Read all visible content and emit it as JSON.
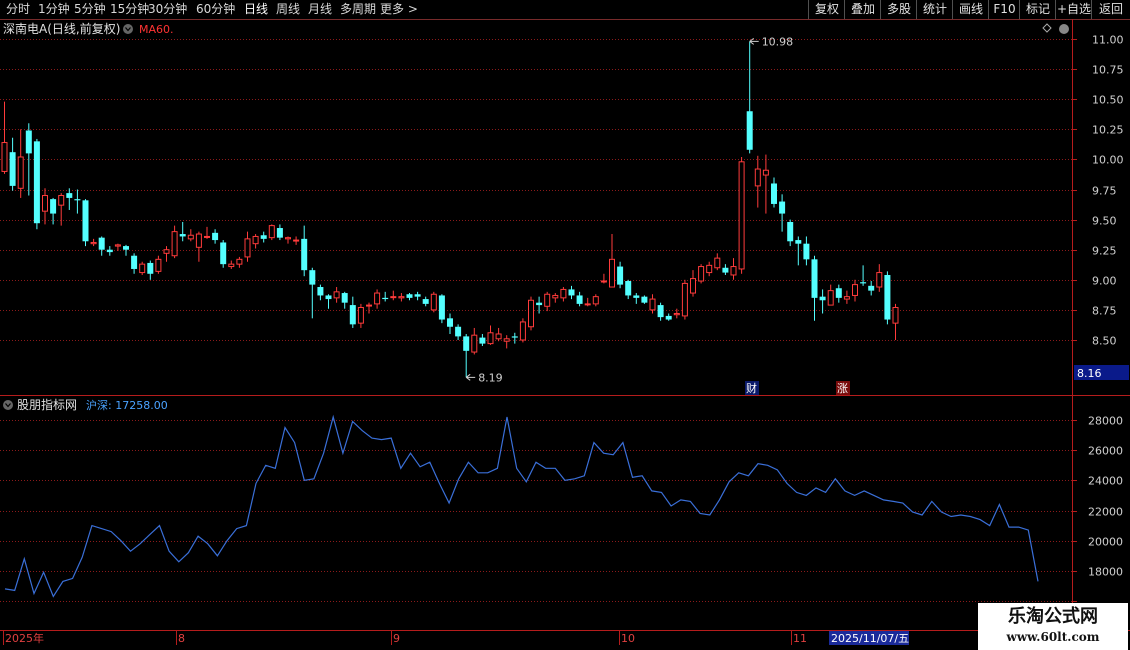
{
  "toolbar": {
    "periods": [
      "分时",
      "1分钟",
      "5分钟",
      "15分钟",
      "30分钟",
      "60分钟",
      "日线",
      "周线",
      "月线",
      "多周期",
      "更多 >"
    ],
    "active_period": "日线",
    "actions": [
      "复权",
      "叠加",
      "多股",
      "统计",
      "画线",
      "F10",
      "标记",
      "+自选",
      "返回"
    ]
  },
  "colors": {
    "up": "#ff3b3b",
    "down": "#54ffff",
    "grid": "#8b1a1a",
    "axis_red": "#b51c1c",
    "line": "#3a6fd8",
    "ma": "#ff3333",
    "label_blue": "#4aa2ff"
  },
  "price_panel": {
    "title": "深南电A(日线,前复权)",
    "indicator": "MA60.",
    "high_marker": "10.98",
    "low_marker": "8.19",
    "current_price": "8.16",
    "event_badges": [
      "财",
      "涨"
    ],
    "settings_icon": "diamond-icon"
  },
  "indicator_panel": {
    "title": "股朋指标网",
    "value_label": "沪深: 17258.00"
  },
  "time_axis": {
    "labels": [
      "2025年",
      "8",
      "9",
      "10",
      "11"
    ],
    "crosshair_date": "2025/11/07/五"
  },
  "watermark": {
    "line1": "乐淘公式网",
    "line2": "www.60lt.com"
  },
  "chart_data": [
    {
      "type": "candlestick",
      "title": "深南电A(日线,前复权)",
      "ylim": [
        8.3,
        11.1
      ],
      "yticks": [
        8.5,
        8.75,
        9.0,
        9.25,
        9.5,
        9.75,
        10.0,
        10.25,
        10.5,
        10.75,
        11.0
      ],
      "annotations": [
        {
          "label": "10.98",
          "value": 10.98
        },
        {
          "label": "8.19",
          "value": 8.19
        }
      ],
      "candles": [
        [
          9.9,
          10.14,
          10.48,
          9.88
        ],
        [
          10.06,
          9.78,
          10.18,
          9.74
        ],
        [
          9.76,
          10.02,
          10.25,
          9.68
        ],
        [
          10.24,
          10.05,
          10.3,
          9.7
        ],
        [
          10.15,
          9.47,
          10.17,
          9.42
        ],
        [
          9.57,
          9.7,
          9.76,
          9.46
        ],
        [
          9.67,
          9.55,
          9.68,
          9.46
        ],
        [
          9.62,
          9.7,
          9.72,
          9.45
        ],
        [
          9.72,
          9.68,
          9.76,
          9.58
        ],
        [
          9.67,
          9.66,
          9.75,
          9.55
        ],
        [
          9.66,
          9.32,
          9.67,
          9.28
        ],
        [
          9.3,
          9.31,
          9.34,
          9.28
        ],
        [
          9.35,
          9.25,
          9.36,
          9.2
        ],
        [
          9.25,
          9.23,
          9.28,
          9.2
        ],
        [
          9.28,
          9.29,
          9.3,
          9.24
        ],
        [
          9.28,
          9.25,
          9.29,
          9.2
        ],
        [
          9.2,
          9.09,
          9.22,
          9.05
        ],
        [
          9.06,
          9.13,
          9.15,
          9.04
        ],
        [
          9.14,
          9.05,
          9.16,
          9.0
        ],
        [
          9.07,
          9.17,
          9.2,
          9.05
        ],
        [
          9.22,
          9.25,
          9.28,
          9.15
        ],
        [
          9.2,
          9.4,
          9.45,
          9.18
        ],
        [
          9.38,
          9.36,
          9.48,
          9.32
        ],
        [
          9.34,
          9.37,
          9.42,
          9.32
        ],
        [
          9.27,
          9.38,
          9.4,
          9.15
        ],
        [
          9.36,
          9.36,
          9.44,
          9.34
        ],
        [
          9.39,
          9.33,
          9.42,
          9.3
        ],
        [
          9.31,
          9.13,
          9.33,
          9.1
        ],
        [
          9.11,
          9.13,
          9.16,
          9.09
        ],
        [
          9.13,
          9.17,
          9.19,
          9.1
        ],
        [
          9.19,
          9.34,
          9.4,
          9.15
        ],
        [
          9.3,
          9.36,
          9.38,
          9.26
        ],
        [
          9.37,
          9.34,
          9.4,
          9.31
        ],
        [
          9.35,
          9.45,
          9.46,
          9.33
        ],
        [
          9.43,
          9.35,
          9.46,
          9.33
        ],
        [
          9.34,
          9.35,
          9.36,
          9.3
        ],
        [
          9.33,
          9.33,
          9.36,
          9.29
        ],
        [
          9.34,
          9.08,
          9.45,
          9.03
        ],
        [
          9.08,
          8.96,
          9.1,
          8.68
        ],
        [
          8.94,
          8.87,
          8.96,
          8.83
        ],
        [
          8.87,
          8.84,
          8.88,
          8.76
        ],
        [
          8.85,
          8.9,
          8.94,
          8.81
        ],
        [
          8.89,
          8.81,
          8.9,
          8.76
        ],
        [
          8.79,
          8.63,
          8.86,
          8.6
        ],
        [
          8.64,
          8.77,
          8.8,
          8.6
        ],
        [
          8.79,
          8.79,
          8.81,
          8.72
        ],
        [
          8.8,
          8.89,
          8.92,
          8.76
        ],
        [
          8.85,
          8.84,
          8.9,
          8.82
        ],
        [
          8.86,
          8.86,
          8.91,
          8.83
        ],
        [
          8.85,
          8.86,
          8.89,
          8.82
        ],
        [
          8.88,
          8.85,
          8.89,
          8.83
        ],
        [
          8.88,
          8.86,
          8.9,
          8.83
        ],
        [
          8.84,
          8.8,
          8.86,
          8.78
        ],
        [
          8.75,
          8.88,
          8.9,
          8.73
        ],
        [
          8.87,
          8.67,
          8.88,
          8.64
        ],
        [
          8.68,
          8.61,
          8.72,
          8.55
        ],
        [
          8.61,
          8.53,
          8.63,
          8.5
        ],
        [
          8.53,
          8.41,
          8.55,
          8.19
        ],
        [
          8.4,
          8.54,
          8.6,
          8.38
        ],
        [
          8.52,
          8.47,
          8.55,
          8.45
        ],
        [
          8.47,
          8.56,
          8.62,
          8.46
        ],
        [
          8.51,
          8.55,
          8.6,
          8.49
        ],
        [
          8.49,
          8.51,
          8.54,
          8.43
        ],
        [
          8.53,
          8.52,
          8.56,
          8.47
        ],
        [
          8.5,
          8.65,
          8.68,
          8.48
        ],
        [
          8.61,
          8.83,
          8.86,
          8.58
        ],
        [
          8.81,
          8.79,
          8.86,
          8.72
        ],
        [
          8.78,
          8.88,
          8.9,
          8.74
        ],
        [
          8.85,
          8.87,
          8.89,
          8.81
        ],
        [
          8.85,
          8.92,
          8.94,
          8.82
        ],
        [
          8.92,
          8.87,
          8.95,
          8.84
        ],
        [
          8.87,
          8.8,
          8.9,
          8.78
        ],
        [
          8.8,
          8.8,
          8.85,
          8.78
        ],
        [
          8.8,
          8.86,
          8.88,
          8.78
        ],
        [
          8.99,
          8.99,
          9.05,
          8.97
        ],
        [
          8.94,
          9.17,
          9.38,
          8.96
        ],
        [
          9.11,
          8.96,
          9.15,
          8.93
        ],
        [
          8.99,
          8.87,
          9.0,
          8.84
        ],
        [
          8.87,
          8.85,
          8.89,
          8.8
        ],
        [
          8.86,
          8.81,
          8.87,
          8.8
        ],
        [
          8.75,
          8.84,
          8.88,
          8.72
        ],
        [
          8.79,
          8.69,
          8.81,
          8.66
        ],
        [
          8.7,
          8.67,
          8.72,
          8.66
        ],
        [
          8.71,
          8.72,
          8.76,
          8.68
        ],
        [
          8.7,
          8.97,
          9.0,
          8.67
        ],
        [
          8.89,
          9.01,
          9.08,
          8.86
        ],
        [
          8.99,
          9.11,
          9.13,
          8.97
        ],
        [
          9.06,
          9.12,
          9.15,
          9.03
        ],
        [
          9.1,
          9.18,
          9.22,
          9.08
        ],
        [
          9.1,
          9.06,
          9.13,
          9.04
        ],
        [
          9.04,
          9.11,
          9.18,
          9.0
        ],
        [
          9.09,
          9.98,
          10.02,
          9.05
        ],
        [
          10.4,
          10.08,
          10.98,
          10.05
        ],
        [
          9.78,
          9.92,
          10.03,
          9.6
        ],
        [
          9.87,
          9.91,
          10.04,
          9.55
        ],
        [
          9.8,
          9.63,
          9.85,
          9.6
        ],
        [
          9.65,
          9.55,
          9.71,
          9.4
        ],
        [
          9.48,
          9.32,
          9.5,
          9.28
        ],
        [
          9.33,
          9.3,
          9.36,
          9.12
        ],
        [
          9.3,
          9.17,
          9.36,
          9.12
        ],
        [
          9.17,
          8.85,
          9.2,
          8.66
        ],
        [
          8.86,
          8.83,
          8.92,
          8.72
        ],
        [
          8.79,
          8.91,
          8.96,
          8.8
        ],
        [
          8.93,
          8.85,
          8.96,
          8.81
        ],
        [
          8.84,
          8.86,
          8.91,
          8.8
        ],
        [
          8.87,
          8.96,
          9.0,
          8.82
        ],
        [
          8.98,
          8.97,
          9.12,
          8.95
        ],
        [
          8.95,
          8.91,
          8.99,
          8.87
        ],
        [
          8.94,
          9.06,
          9.13,
          8.9
        ],
        [
          9.04,
          8.67,
          9.07,
          8.63
        ],
        [
          8.64,
          8.77,
          8.8,
          8.5
        ]
      ]
    },
    {
      "type": "line",
      "title": "股朋指标网",
      "ylim": [
        16000,
        29200
      ],
      "yticks": [
        16000,
        18000,
        20000,
        22000,
        24000,
        26000,
        28000
      ],
      "series": [
        {
          "name": "沪深",
          "values": [
            16800,
            16700,
            18800,
            16500,
            17900,
            16300,
            17300,
            17500,
            18900,
            21000,
            20800,
            20600,
            20000,
            19300,
            19800,
            20400,
            21000,
            19300,
            18600,
            19200,
            20300,
            19800,
            19000,
            20000,
            20800,
            21000,
            23800,
            25000,
            24800,
            27500,
            26500,
            24000,
            24100,
            25800,
            28200,
            25800,
            27900,
            27300,
            26800,
            26700,
            26800,
            24800,
            25800,
            24900,
            25200,
            23800,
            22500,
            24100,
            25200,
            24500,
            24500,
            24800,
            28200,
            24800,
            23900,
            25200,
            24800,
            24800,
            24000,
            24100,
            24300,
            26500,
            25800,
            25700,
            26500,
            24200,
            24300,
            23300,
            23200,
            22300,
            22700,
            22600,
            21800,
            21700,
            22700,
            23900,
            24500,
            24300,
            25100,
            25000,
            24700,
            23800,
            23200,
            23000,
            23500,
            23200,
            24100,
            23300,
            23000,
            23300,
            23000,
            22700,
            22600,
            22500,
            21900,
            21700,
            22600,
            21900,
            21600,
            21700,
            21600,
            21400,
            21000,
            22400,
            20900,
            20900,
            20700,
            17300
          ]
        }
      ]
    }
  ]
}
